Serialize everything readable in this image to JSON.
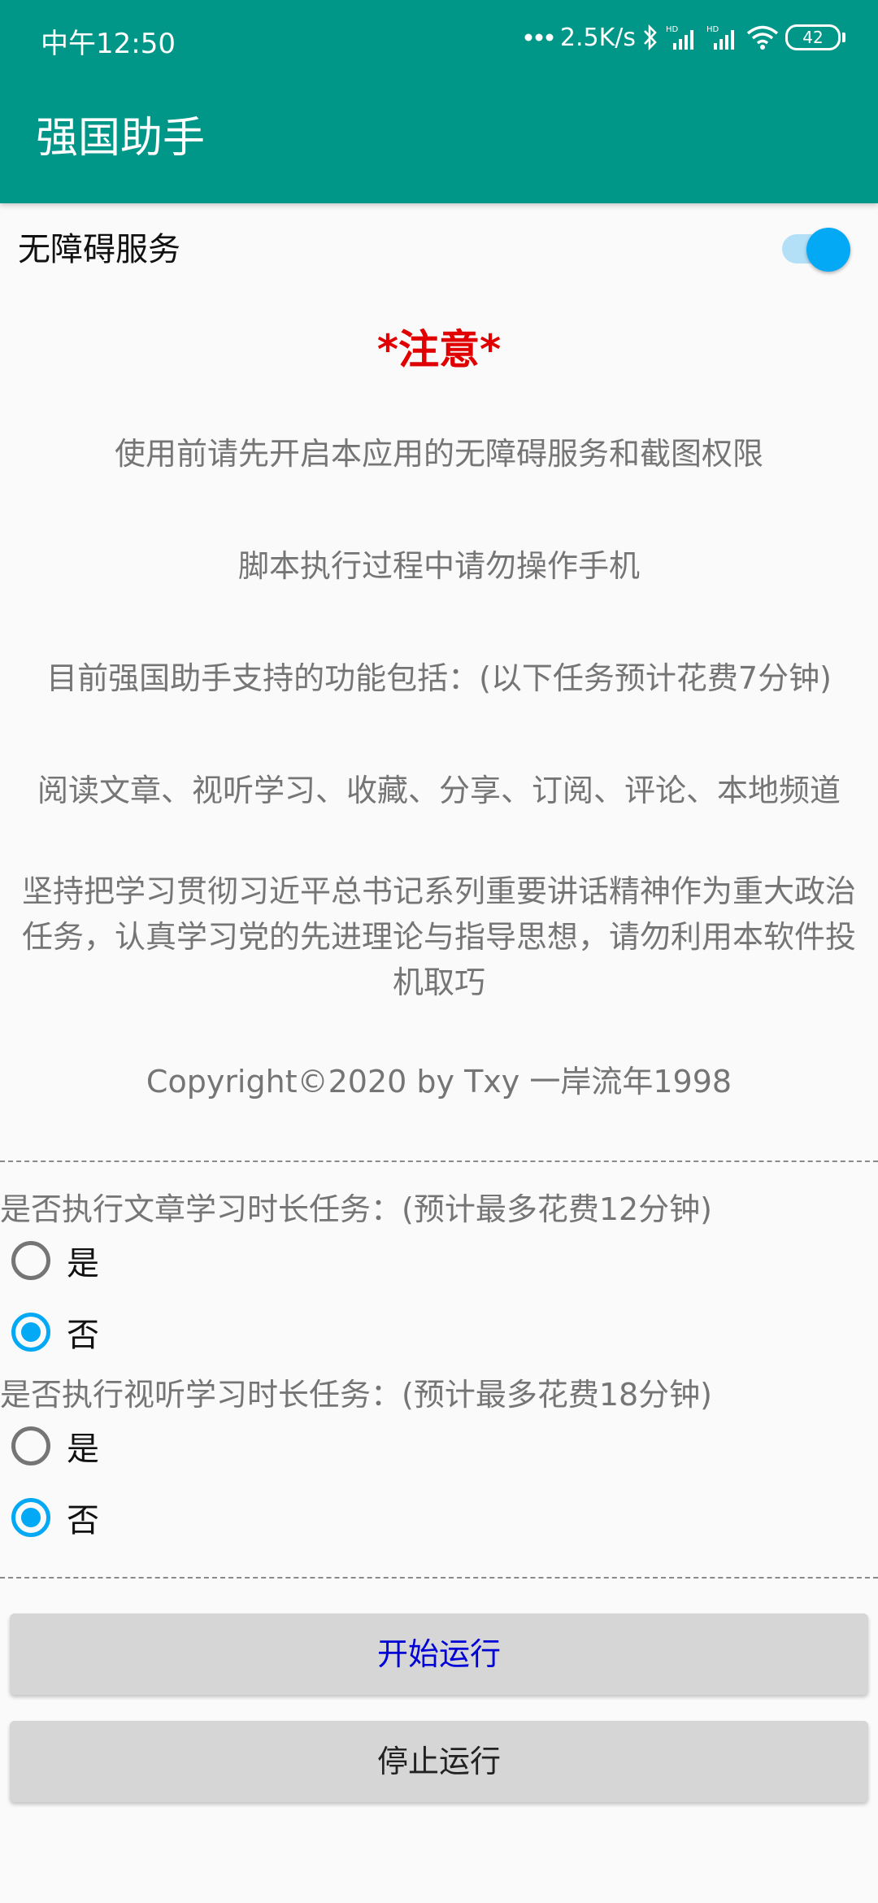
{
  "status_bar": {
    "time": "中午12:50",
    "network_speed": "2.5K/s",
    "battery_level": "42"
  },
  "app_bar": {
    "title": "强国助手"
  },
  "accessibility": {
    "label": "无障碍服务",
    "enabled": true
  },
  "notice": {
    "title": "*注意*",
    "line1": "使用前请先开启本应用的无障碍服务和截图权限",
    "line2": "脚本执行过程中请勿操作手机",
    "line3": "目前强国助手支持的功能包括：(以下任务预计花费7分钟)",
    "line4": "阅读文章、视听学习、收藏、分享、订阅、评论、本地频道",
    "line5": "坚持把学习贯彻习近平总书记系列重要讲话精神作为重大政治任务，认真学习党的先进理论与指导思想，请勿利用本软件投机取巧",
    "copyright": "Copyright©2020 by Txy 一岸流年1998"
  },
  "article_task": {
    "question": "是否执行文章学习时长任务：(预计最多花费12分钟)",
    "yes_label": "是",
    "no_label": "否",
    "selected": "否"
  },
  "video_task": {
    "question": "是否执行视听学习时长任务：(预计最多花费18分钟)",
    "yes_label": "是",
    "no_label": "否",
    "selected": "否"
  },
  "buttons": {
    "start_label": "开始运行",
    "stop_label": "停止运行"
  },
  "colors": {
    "app_bar": "#009688",
    "accent": "#03a9f4",
    "notice_title": "#e00000",
    "start_text": "#0000d6"
  }
}
